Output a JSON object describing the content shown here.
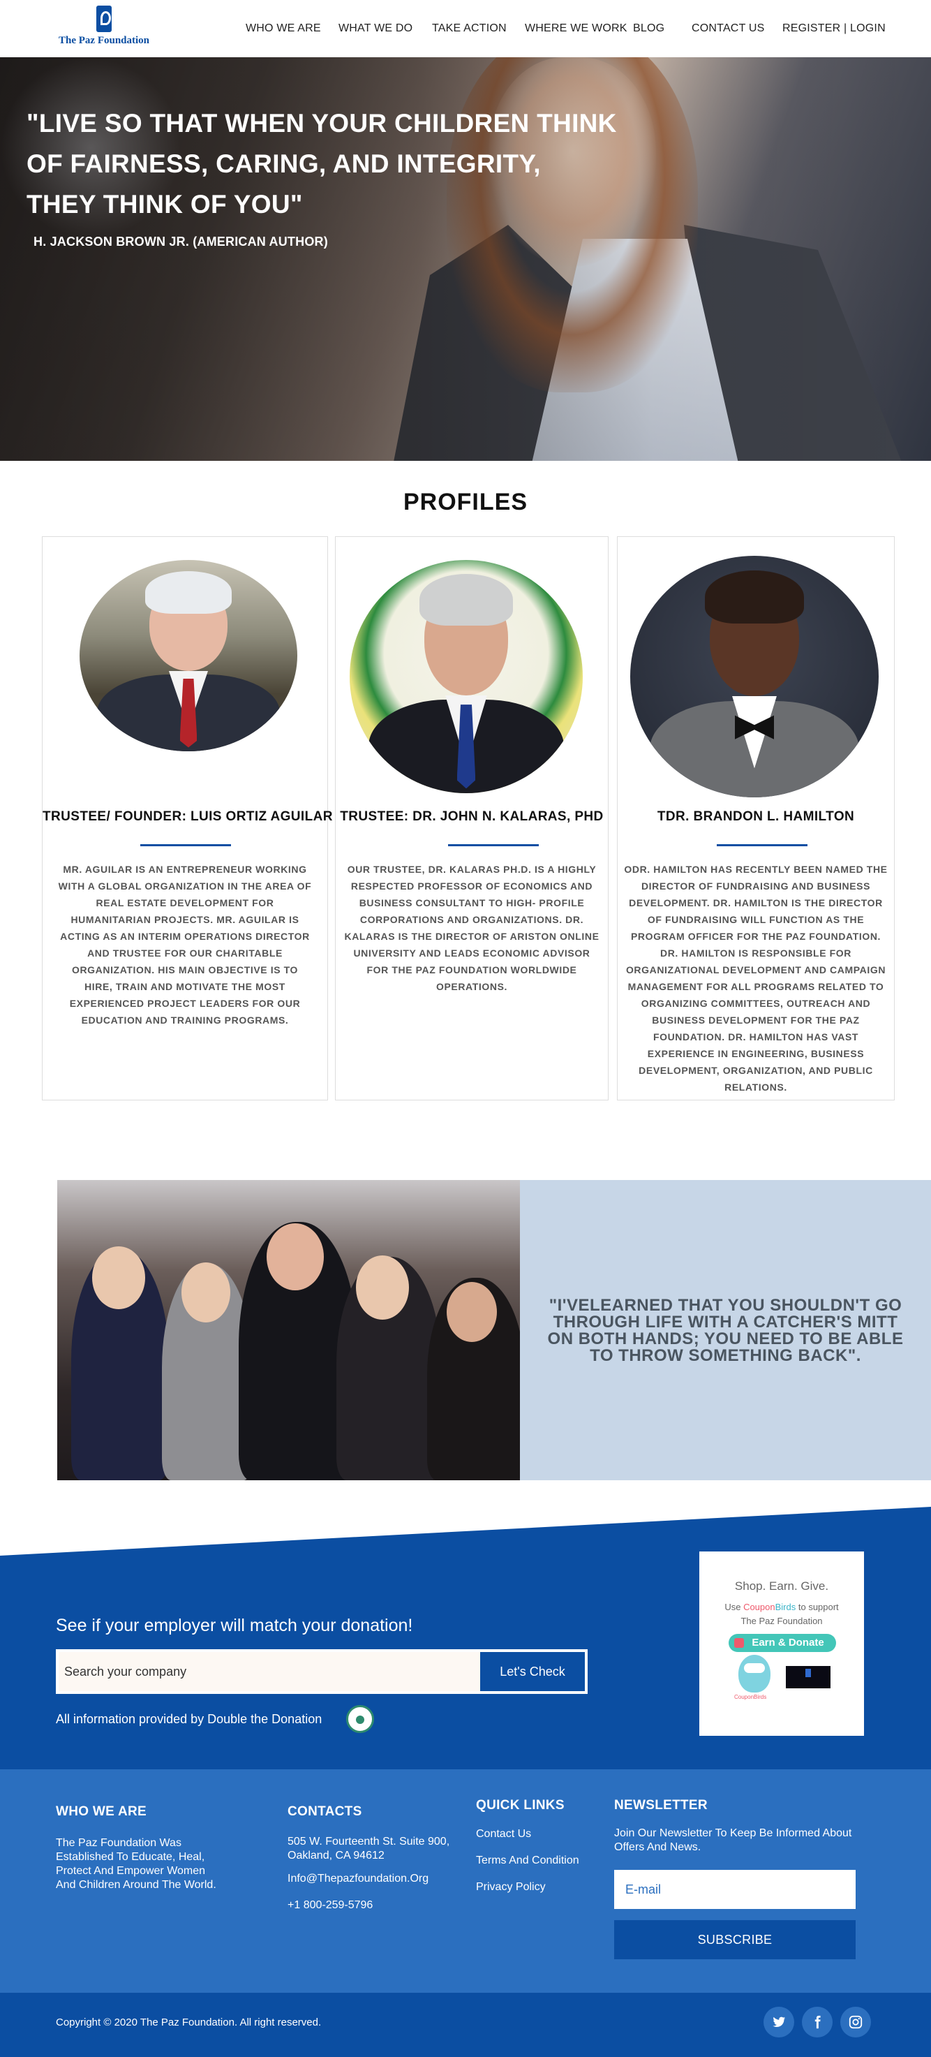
{
  "brand": {
    "name": "The Paz Foundation"
  },
  "nav": {
    "items": [
      "WHO WE ARE",
      "WHAT WE DO",
      "TAKE ACTION",
      "WHERE WE WORK",
      "BLOG",
      "CONTACT US",
      "REGISTER | LOGIN"
    ]
  },
  "hero": {
    "quote_line1": "\"LIVE SO THAT WHEN YOUR CHILDREN THINK",
    "quote_line2": "OF FAIRNESS, CARING, AND INTEGRITY,",
    "quote_line3": "THEY THINK OF YOU\"",
    "author": "H. JACKSON BROWN JR. (AMERICAN AUTHOR)"
  },
  "profiles": {
    "title": "PROFILES",
    "cards": [
      {
        "title": "TRUSTEE/ FOUNDER: LUIS ORTIZ  AGUILAR",
        "text": "MR. AGUILAR IS AN ENTREPRENEUR WORKING WITH A GLOBAL ORGANIZATION IN THE AREA OF REAL ESTATE DEVELOPMENT FOR HUMANITARIAN PROJECTS. MR. AGUILAR IS ACTING AS AN INTERIM OPERATIONS DIRECTOR AND TRUSTEE FOR OUR CHARITABLE ORGANIZATION. HIS MAIN OBJECTIVE IS TO HIRE, TRAIN AND MOTIVATE THE MOST EXPERIENCED PROJECT LEADERS FOR OUR EDUCATION AND TRAINING PROGRAMS."
      },
      {
        "title": "TRUSTEE: DR. JOHN N. KALARAS, PHD",
        "text": "OUR TRUSTEE, DR. KALARAS PH.D. IS A HIGHLY RESPECTED PROFESSOR OF ECONOMICS AND BUSINESS CONSULTANT TO HIGH- PROFILE CORPORATIONS AND ORGANIZATIONS. DR. KALARAS IS THE DIRECTOR OF ARISTON ONLINE UNIVERSITY AND LEADS ECONOMIC ADVISOR FOR THE PAZ FOUNDATION WORLDWIDE OPERATIONS."
      },
      {
        "title": "TDR. BRANDON L. HAMILTON",
        "text": "ODR. HAMILTON HAS RECENTLY BEEN NAMED THE DIRECTOR OF FUNDRAISING AND BUSINESS DEVELOPMENT. DR. HAMILTON IS THE DIRECTOR OF FUNDRAISING WILL FUNCTION AS THE PROGRAM OFFICER FOR THE PAZ FOUNDATION. DR. HAMILTON IS RESPONSIBLE FOR ORGANIZATIONAL DEVELOPMENT AND CAMPAIGN MANAGEMENT FOR ALL PROGRAMS RELATED TO ORGANIZING COMMITTEES, OUTREACH AND BUSINESS DEVELOPMENT FOR THE PAZ FOUNDATION. DR. HAMILTON HAS VAST EXPERIENCE IN ENGINEERING, BUSINESS DEVELOPMENT, ORGANIZATION, AND PUBLIC RELATIONS."
      }
    ]
  },
  "band": {
    "quote": "\"I'VELEARNED THAT YOU SHOULDN'T GO THROUGH LIFE WITH A CATCHER'S MITT ON BOTH HANDS; YOU NEED TO BE ABLE TO THROW SOMETHING BACK\"."
  },
  "donate": {
    "title": "See if your employer will match your donation!",
    "search_placeholder": "Search your company",
    "button": "Let's Check",
    "note": "All information provided by Double the Donation"
  },
  "shop": {
    "title": "Shop. Earn. Give.",
    "use": "Use",
    "coupon": "Coupon",
    "birds": "Birds",
    "to_support": "to support",
    "org": "The Paz Foundation",
    "button": "Earn & Donate",
    "bird_label": "CouponBirds"
  },
  "footer": {
    "who": {
      "heading": "WHO WE ARE",
      "line1": "The Paz Foundation Was",
      "line2": "Established To Educate, Heal,",
      "line3": "Protect And Empower Women",
      "line4": "And Children Around The World."
    },
    "contacts": {
      "heading": "CONTACTS",
      "address1": "505 W. Fourteenth St. Suite 900,",
      "address2": "Oakland, CA 94612",
      "email": "Info@Thepazfoundation.Org",
      "phone": "+1 800-259-5796"
    },
    "links": {
      "heading": "QUICK LINKS",
      "items": [
        "Contact Us",
        "Terms And Condition",
        "Privacy Policy"
      ]
    },
    "newsletter": {
      "heading": "NEWSLETTER",
      "line1": "Join Our Newsletter To Keep Be Informed About",
      "line2": "Offers And News.",
      "email_placeholder": "E-mail",
      "button": "SUBSCRIBE"
    },
    "copyright": "Copyright © 2020 The Paz Foundation. All right reserved.",
    "social": [
      "twitter-icon",
      "facebook-icon",
      "instagram-icon"
    ]
  },
  "colors": {
    "primary": "#0b4ea2",
    "footer": "#2b6fbf",
    "quote_box": "#c7d6e7"
  }
}
